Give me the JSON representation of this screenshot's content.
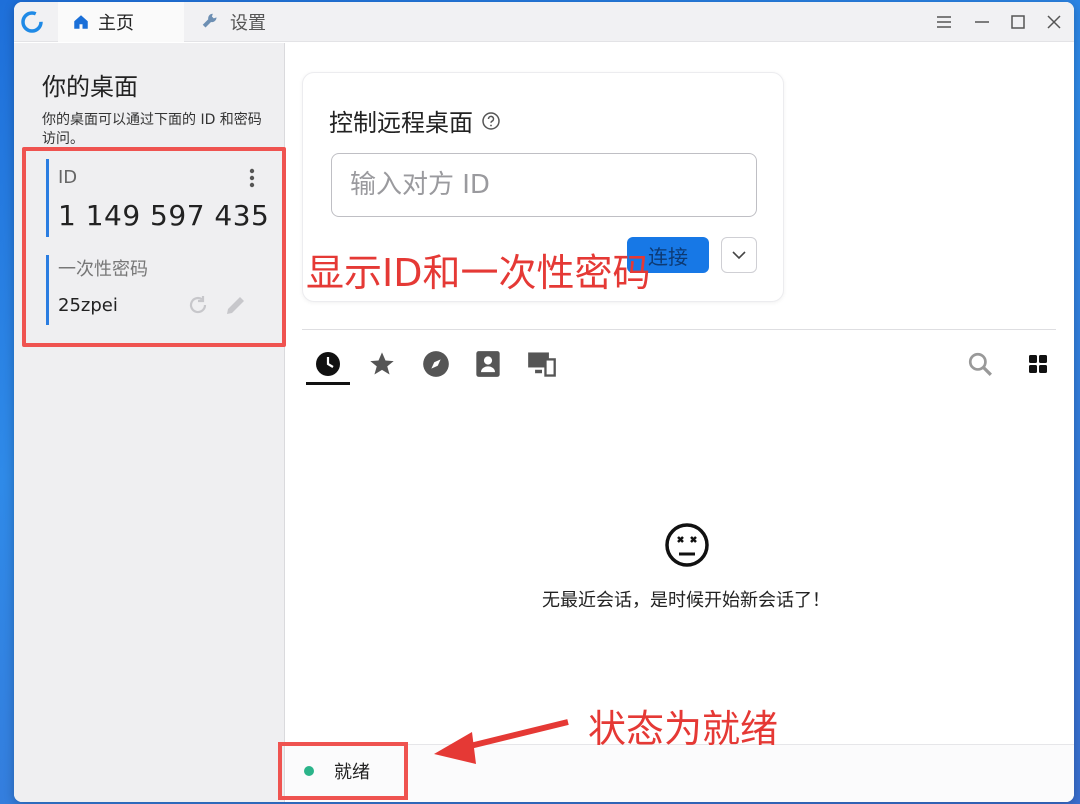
{
  "titlebar": {
    "tabs": [
      {
        "label": "主页",
        "icon": "home-icon",
        "active": true
      },
      {
        "label": "设置",
        "icon": "wrench-icon",
        "active": false
      }
    ],
    "window_controls": [
      "menu-icon",
      "minimize-icon",
      "maximize-icon",
      "close-icon"
    ]
  },
  "left_panel": {
    "title": "你的桌面",
    "description": "你的桌面可以通过下面的 ID 和密码访问。",
    "id_label": "ID",
    "id_value": "1 149 597 435",
    "password_label": "一次性密码",
    "password_value": "25zpei"
  },
  "connect": {
    "title": "控制远程桌面",
    "input_placeholder": "输入对方 ID",
    "connect_label": "连接"
  },
  "session_tabs": [
    "recent-sessions",
    "favorites",
    "discovered",
    "address-book",
    "accessible-devices"
  ],
  "empty_state": {
    "message": "无最近会话，是时候开始新会话了！"
  },
  "status": {
    "text": "就绪",
    "color": "#2bb48a"
  },
  "annotations": {
    "id_callout": "显示ID和一次性密码",
    "status_callout": "状态为就绪"
  },
  "colors": {
    "accent": "#1778e6",
    "annotation": "#e53935"
  }
}
